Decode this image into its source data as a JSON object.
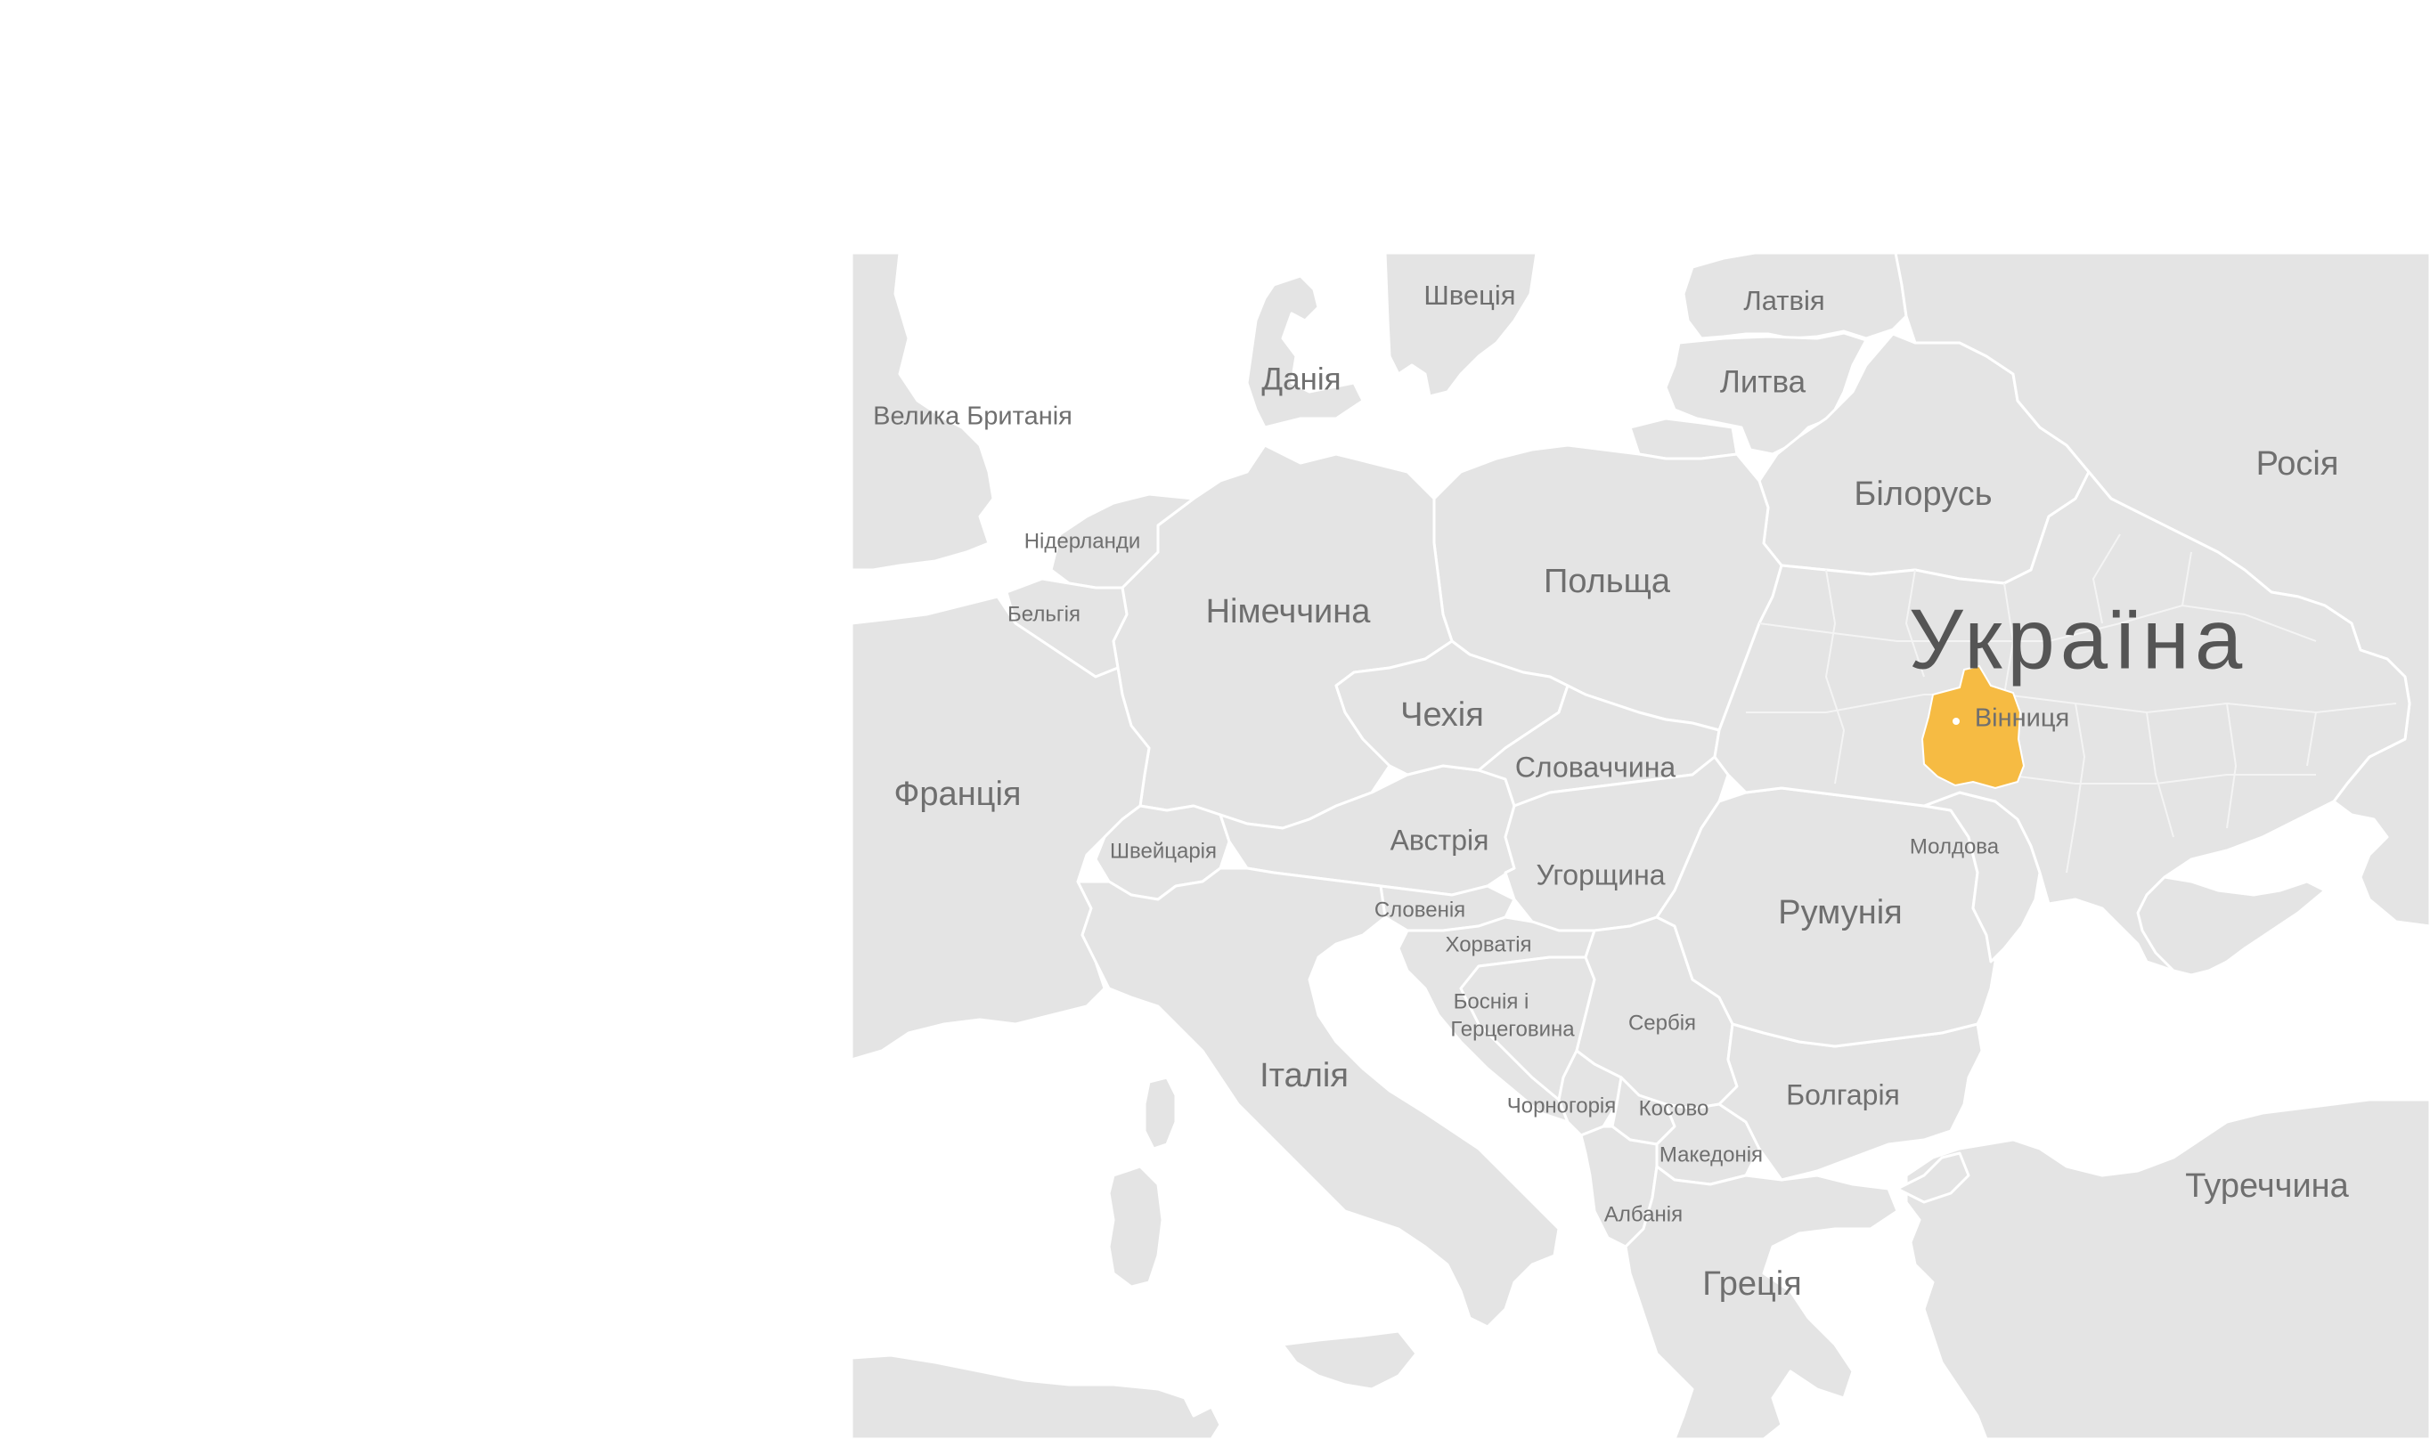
{
  "map": {
    "countries": {
      "sweden": "Швеція",
      "latvia": "Латвія",
      "denmark": "Данія",
      "lithuania": "Литва",
      "uk": "Велика Британія",
      "belarus": "Білорусь",
      "russia": "Росія",
      "netherlands": "Нідерланди",
      "poland": "Польща",
      "germany": "Німеччина",
      "belgium": "Бельгія",
      "ukraine": "Україна",
      "czechia": "Чехія",
      "slovakia": "Словаччина",
      "france": "Франція",
      "switzerland": "Швейцарія",
      "austria": "Австрія",
      "moldova": "Молдова",
      "hungary": "Угорщина",
      "slovenia": "Словенія",
      "romania": "Румунія",
      "croatia": "Хорватія",
      "bosnia_line1": "Боснія і",
      "bosnia_line2": "Герцеговина",
      "serbia": "Сербія",
      "italy": "Італія",
      "bulgaria": "Болгарія",
      "montenegro": "Чорногорія",
      "kosovo": "Косово",
      "macedonia": "Македонія",
      "turkey": "Туреччина",
      "albania": "Албанія",
      "greece": "Греція"
    },
    "highlight": {
      "region_city": "Вінниця",
      "color": "#f6bb43"
    },
    "colors": {
      "land": "#e4e4e4",
      "border": "#ffffff",
      "label": "#6f6f6f",
      "title": "#555555",
      "background": "#ffffff"
    }
  }
}
